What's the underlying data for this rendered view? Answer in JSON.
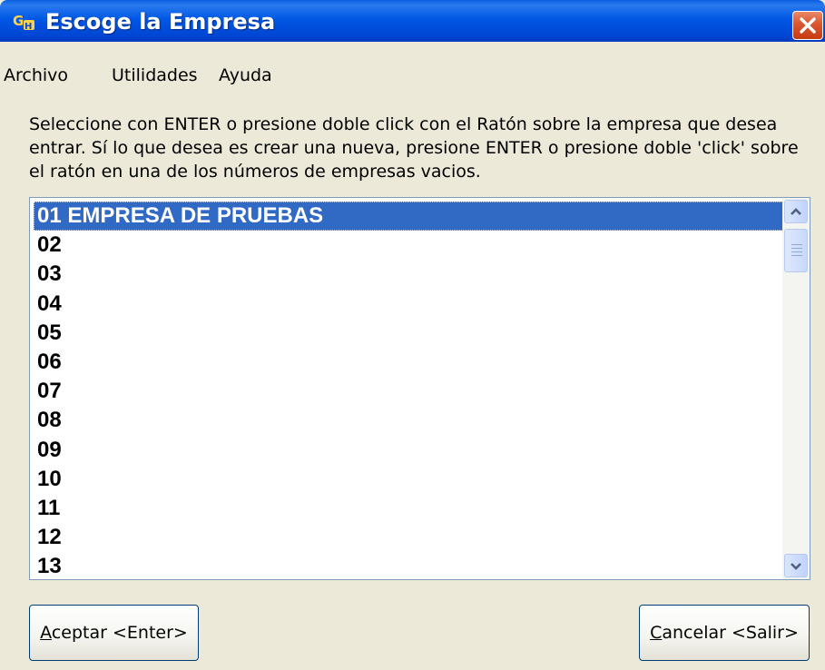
{
  "window": {
    "title": "Escoge la Empresa",
    "icon": "app-logo-icon"
  },
  "menu": [
    "Archivo",
    "Utilidades",
    "Ayuda"
  ],
  "instructions": "Seleccione con ENTER o presione doble click con el Ratón sobre la empresa que desea entrar. Sí lo que desea es crear una nueva, presione ENTER o presione doble 'click' sobre el ratón en una de los números de empresas vacios.",
  "list": {
    "selected_index": 0,
    "items": [
      "01 EMPRESA DE PRUEBAS",
      "02",
      "03",
      "04",
      "05",
      "06",
      "07",
      "08",
      "09",
      "10",
      "11",
      "12",
      "13"
    ]
  },
  "buttons": {
    "accept_mnemonic": "A",
    "accept_rest": "ceptar <Enter>",
    "cancel_mnemonic": "C",
    "cancel_rest": "ancelar <Salir>"
  },
  "colors": {
    "titlebar": "#0058e4",
    "selection": "#316ac5",
    "close": "#d9572f",
    "dialog_bg": "#ece9d8"
  }
}
